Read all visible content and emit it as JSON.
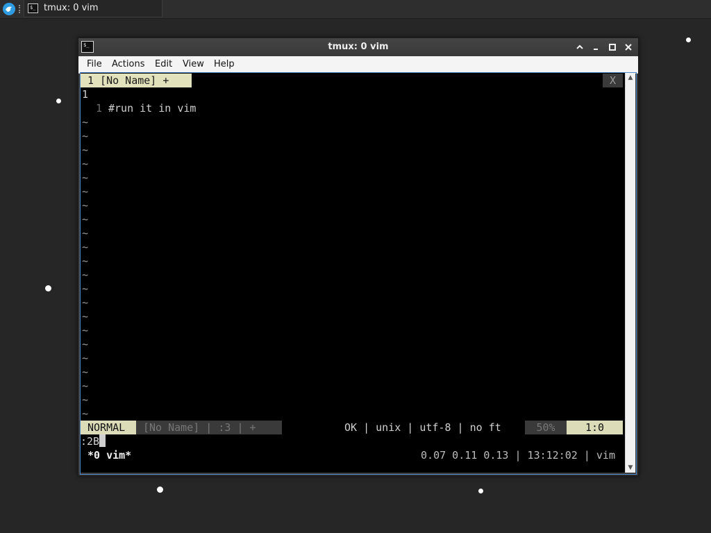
{
  "taskbar": {
    "task_label": "tmux: 0 vim"
  },
  "window": {
    "title": "tmux: 0 vim",
    "menu": [
      "File",
      "Actions",
      "Edit",
      "View",
      "Help"
    ]
  },
  "vim": {
    "tab_label": "1 [No Name] +",
    "tab_close": "X",
    "top_line_number": "1",
    "line_number": "1",
    "line_text": "#run it in vim",
    "tilde": "~",
    "status_mode": "NORMAL",
    "status_info": "[No Name] | :3 | +",
    "status_right": "OK | unix | utf-8 | no ft",
    "status_percent": "50%",
    "status_position": "1:0",
    "command_line": ":2B"
  },
  "tmux": {
    "window_label": "*0 vim*",
    "status_right": "0.07 0.11 0.13 | 13:12:02 | vim"
  },
  "colors": {
    "desktop": "#262626",
    "terminal_bg": "#000000",
    "status_highlight": "#dcdcb8",
    "accent_border": "#4a86c8"
  }
}
